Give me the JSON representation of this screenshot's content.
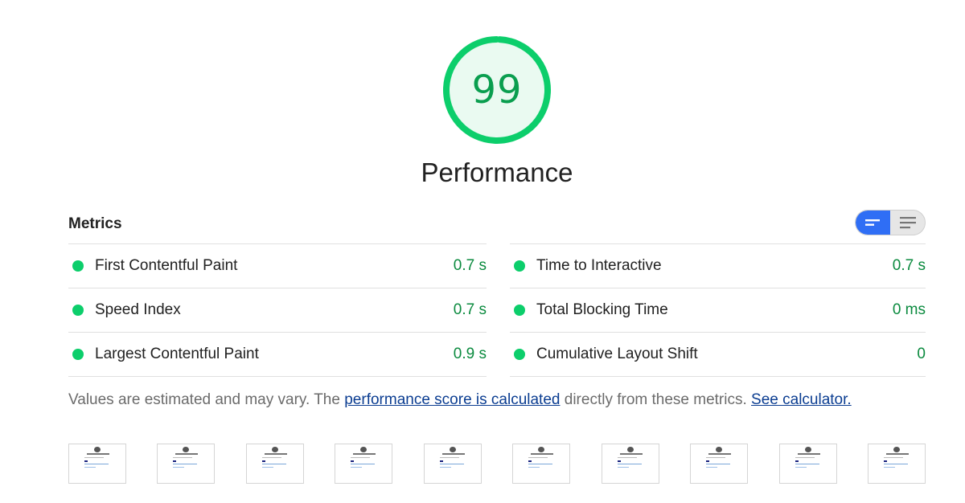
{
  "score": {
    "value": "99",
    "label": "Performance",
    "value_fraction": 0.99,
    "color": "#0cce6b",
    "bg_color": "#eafaf1"
  },
  "metrics": {
    "title": "Metrics",
    "toggle": {
      "options": [
        "collapsed-view-icon",
        "expanded-view-icon"
      ],
      "active": "collapsed-view-icon",
      "active_color": "#2f6ef5"
    },
    "left": [
      {
        "label": "First Contentful Paint",
        "value": "0.7 s"
      },
      {
        "label": "Speed Index",
        "value": "0.7 s"
      },
      {
        "label": "Largest Contentful Paint",
        "value": "0.9 s"
      }
    ],
    "right": [
      {
        "label": "Time to Interactive",
        "value": "0.7 s"
      },
      {
        "label": "Total Blocking Time",
        "value": "0 ms"
      },
      {
        "label": "Cumulative Layout Shift",
        "value": "0"
      }
    ],
    "status_color": "#0cce6b"
  },
  "footnote": {
    "text_before": "Values are estimated and may vary. The ",
    "link1": "performance score is calculated",
    "text_middle": " directly from these metrics. ",
    "link2": "See calculator."
  },
  "filmstrip": {
    "frame_count": 10
  }
}
